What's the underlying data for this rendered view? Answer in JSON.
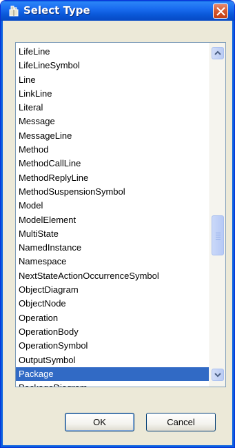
{
  "window": {
    "title": "Select Type",
    "icon": "package-icon",
    "close": "close-icon"
  },
  "list": {
    "items": [
      "LifeLine",
      "LifeLineSymbol",
      "Line",
      "LinkLine",
      "Literal",
      "Message",
      "MessageLine",
      "Method",
      "MethodCallLine",
      "MethodReplyLine",
      "MethodSuspensionSymbol",
      "Model",
      "ModelElement",
      "MultiState",
      "NamedInstance",
      "Namespace",
      "NextStateActionOccurrenceSymbol",
      "ObjectDiagram",
      "ObjectNode",
      "Operation",
      "OperationBody",
      "OperationSymbol",
      "OutputSymbol",
      "Package",
      "PackageDiagram"
    ],
    "selected": "Package"
  },
  "buttons": {
    "ok": "OK",
    "cancel": "Cancel"
  },
  "colors": {
    "titlebar": "#0a5fdf",
    "selection": "#316ac5",
    "close": "#d4582f",
    "dialog_bg": "#ece9d8"
  }
}
